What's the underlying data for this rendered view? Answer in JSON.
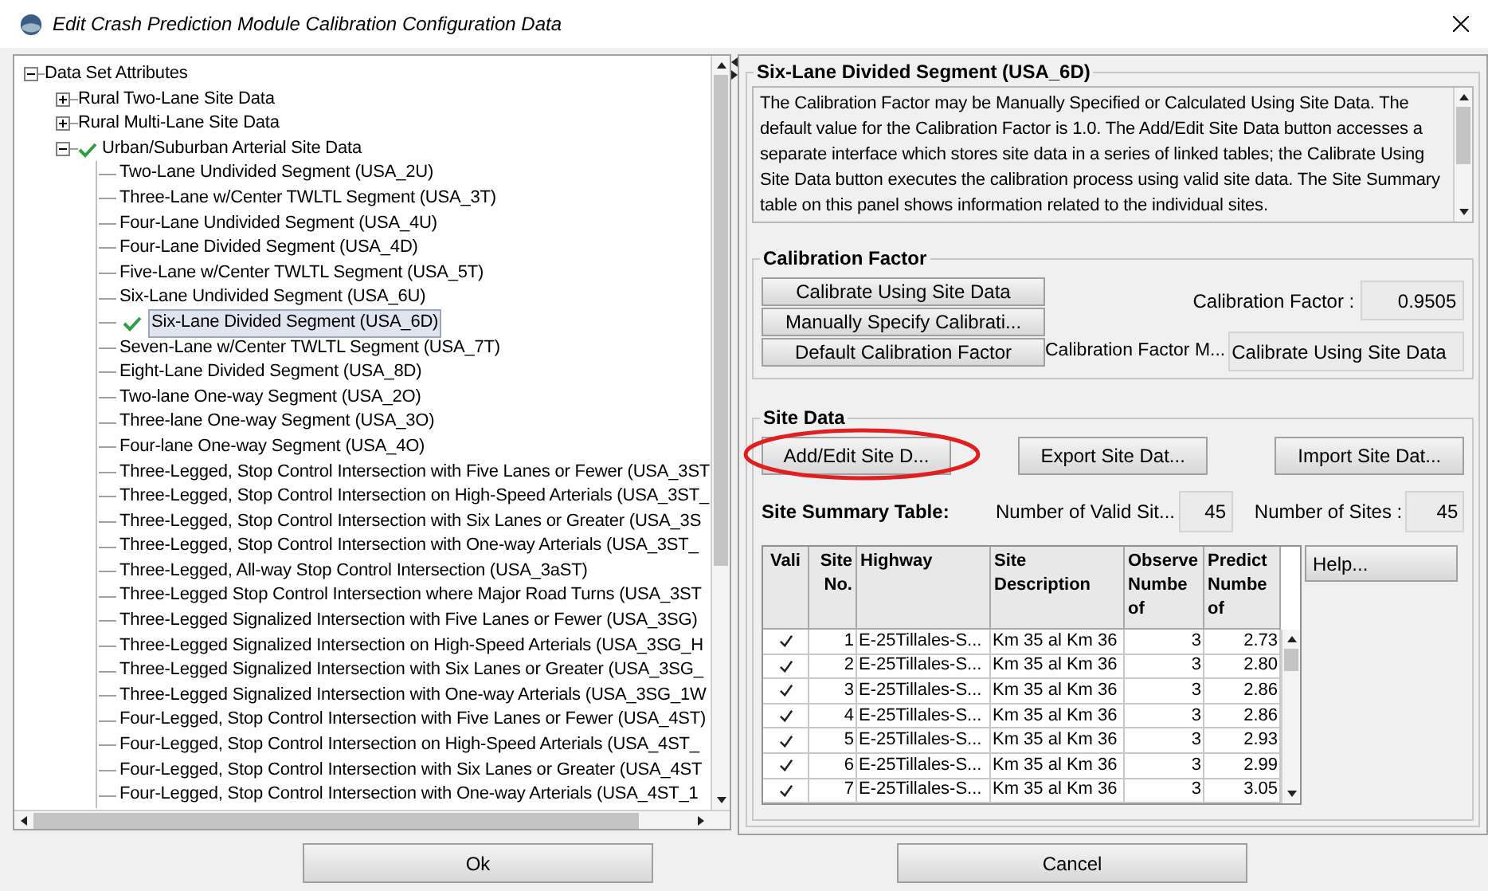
{
  "window": {
    "title": "Edit Crash Prediction Module Calibration Configuration Data"
  },
  "tree": {
    "label": "Data Set Attributes",
    "expanded": true,
    "children": [
      {
        "label": "Rural Two-Lane Site Data",
        "expanded": false,
        "checked": false
      },
      {
        "label": "Rural Multi-Lane Site Data",
        "expanded": false,
        "checked": false
      },
      {
        "label": "Urban/Suburban Arterial Site Data",
        "expanded": true,
        "checked": true,
        "children": [
          {
            "label": "Two-Lane Undivided Segment (USA_2U)",
            "checked": false,
            "selected": false
          },
          {
            "label": "Three-Lane w/Center TWLTL Segment (USA_3T)",
            "checked": false,
            "selected": false
          },
          {
            "label": "Four-Lane Undivided Segment (USA_4U)",
            "checked": false,
            "selected": false
          },
          {
            "label": "Four-Lane Divided Segment (USA_4D)",
            "checked": false,
            "selected": false
          },
          {
            "label": "Five-Lane w/Center TWLTL Segment (USA_5T)",
            "checked": false,
            "selected": false
          },
          {
            "label": "Six-Lane Undivided Segment (USA_6U)",
            "checked": false,
            "selected": false
          },
          {
            "label": "Six-Lane Divided Segment (USA_6D)",
            "checked": true,
            "selected": true
          },
          {
            "label": "Seven-Lane w/Center TWLTL Segment (USA_7T)",
            "checked": false,
            "selected": false
          },
          {
            "label": "Eight-Lane Divided Segment (USA_8D)",
            "checked": false,
            "selected": false
          },
          {
            "label": "Two-lane One-way Segment (USA_2O)",
            "checked": false,
            "selected": false
          },
          {
            "label": "Three-lane One-way Segment (USA_3O)",
            "checked": false,
            "selected": false
          },
          {
            "label": "Four-lane One-way Segment (USA_4O)",
            "checked": false,
            "selected": false
          },
          {
            "label": "Three-Legged, Stop Control Intersection with Five Lanes or Fewer (USA_3ST",
            "checked": false,
            "selected": false
          },
          {
            "label": "Three-Legged, Stop Control Intersection on High-Speed Arterials (USA_3ST_",
            "checked": false,
            "selected": false
          },
          {
            "label": "Three-Legged, Stop Control Intersection with Six Lanes or Greater (USA_3S",
            "checked": false,
            "selected": false
          },
          {
            "label": "Three-Legged, Stop Control Intersection with One-way Arterials (USA_3ST_",
            "checked": false,
            "selected": false
          },
          {
            "label": "Three-Legged, All-way Stop Control Intersection (USA_3aST)",
            "checked": false,
            "selected": false
          },
          {
            "label": "Three-Legged Stop Control Intersection where Major Road Turns (USA_3ST",
            "checked": false,
            "selected": false
          },
          {
            "label": "Three-Legged Signalized Intersection with Five Lanes or Fewer (USA_3SG)",
            "checked": false,
            "selected": false
          },
          {
            "label": "Three-Legged Signalized Intersection on High-Speed Arterials (USA_3SG_H",
            "checked": false,
            "selected": false
          },
          {
            "label": "Three-Legged Signalized Intersection with Six Lanes or Greater (USA_3SG_",
            "checked": false,
            "selected": false
          },
          {
            "label": "Three-Legged Signalized Intersection with One-way Arterials (USA_3SG_1W",
            "checked": false,
            "selected": false
          },
          {
            "label": "Four-Legged, Stop Control Intersection with Five Lanes or Fewer (USA_4ST)",
            "checked": false,
            "selected": false
          },
          {
            "label": "Four-Legged, Stop Control Intersection on High-Speed Arterials (USA_4ST_",
            "checked": false,
            "selected": false
          },
          {
            "label": "Four-Legged, Stop Control Intersection with Six Lanes or Greater (USA_4ST",
            "checked": false,
            "selected": false
          },
          {
            "label": "Four-Legged, Stop Control Intersection with One-way Arterials (USA_4ST_1",
            "checked": false,
            "selected": false
          }
        ]
      }
    ]
  },
  "detail": {
    "title": "Six-Lane Divided Segment (USA_6D)",
    "description": "The Calibration Factor may be Manually Specified or Calculated Using Site Data. The default value for the Calibration Factor is 1.0. The Add/Edit Site Data button accesses a separate interface which stores site data in a series of linked tables; the Calibrate Using Site Data button executes the calibration process using valid site data. The Site Summary table on this panel shows information related to the individual sites.",
    "calibration": {
      "title": "Calibration Factor",
      "buttons": [
        "Calibrate Using Site Data",
        "Manually Specify Calibrati...",
        "Default Calibration Factor"
      ],
      "factor_label": "Calibration Factor :",
      "factor_value": "0.9505",
      "method_label": "Calibration Factor M...",
      "method_value": "Calibrate Using Site Data"
    },
    "site_data": {
      "title": "Site Data",
      "buttons": [
        {
          "label": "Add/Edit Site D...",
          "circled": true
        },
        {
          "label": "Export Site Dat...",
          "circled": false
        },
        {
          "label": "Import Site Dat...",
          "circled": false
        }
      ],
      "summary_label": "Site Summary Table:",
      "valid_label": "Number of Valid Sit...",
      "valid_value": "45",
      "sites_label": "Number of Sites :",
      "sites_value": "45",
      "help_button": "Help...",
      "table": {
        "columns": [
          {
            "lines": [
              "Vali"
            ]
          },
          {
            "lines": [
              "Site",
              "No."
            ]
          },
          {
            "lines": [
              "Highway"
            ]
          },
          {
            "lines": [
              "Site",
              "Description"
            ]
          },
          {
            "lines": [
              "Observe",
              "Numbe",
              "of"
            ]
          },
          {
            "lines": [
              "Predict",
              "Numbe",
              "of"
            ]
          }
        ],
        "rows": [
          {
            "valid": true,
            "site_no": "1",
            "highway": "E-25Tillales-S...",
            "description": "Km 35 al Km 36",
            "observed": "3",
            "predicted": "2.73"
          },
          {
            "valid": true,
            "site_no": "2",
            "highway": "E-25Tillales-S...",
            "description": "Km 35 al Km 36",
            "observed": "3",
            "predicted": "2.80"
          },
          {
            "valid": true,
            "site_no": "3",
            "highway": "E-25Tillales-S...",
            "description": "Km 35 al Km 36",
            "observed": "3",
            "predicted": "2.86"
          },
          {
            "valid": true,
            "site_no": "4",
            "highway": "E-25Tillales-S...",
            "description": "Km 35 al Km 36",
            "observed": "3",
            "predicted": "2.86"
          },
          {
            "valid": true,
            "site_no": "5",
            "highway": "E-25Tillales-S...",
            "description": "Km 35 al Km 36",
            "observed": "3",
            "predicted": "2.93"
          },
          {
            "valid": true,
            "site_no": "6",
            "highway": "E-25Tillales-S...",
            "description": "Km 35 al Km 36",
            "observed": "3",
            "predicted": "2.99"
          },
          {
            "valid": true,
            "site_no": "7",
            "highway": "E-25Tillales-S...",
            "description": "Km 35 al Km 36",
            "observed": "3",
            "predicted": "3.05"
          }
        ]
      }
    }
  },
  "buttons": [
    "Ok",
    "Cancel"
  ]
}
